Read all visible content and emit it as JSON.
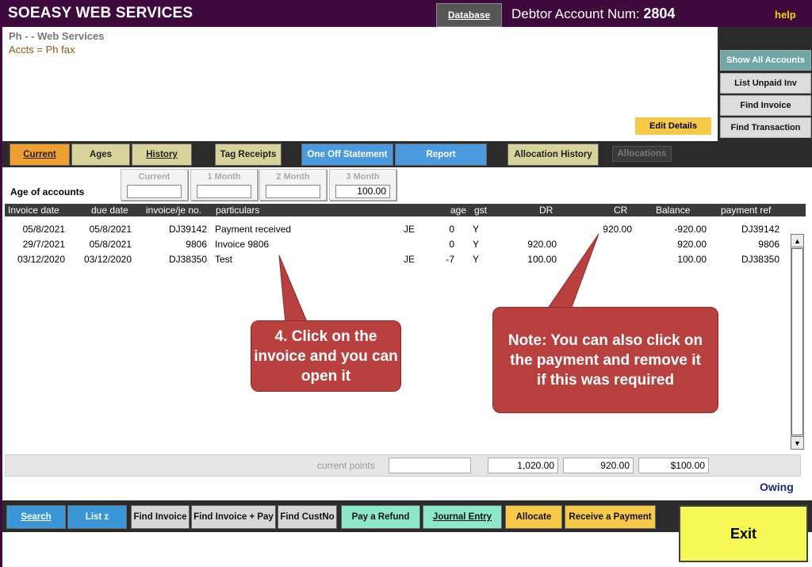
{
  "header": {
    "app_title": "SOEASY WEB SERVICES",
    "database_button": "Database",
    "debtor_label": "Debtor Account Num:",
    "debtor_number": "2804",
    "help": "help"
  },
  "info": {
    "line1": "Ph  -  - Web Services",
    "line2": "Accts =  Ph  fax"
  },
  "side_buttons": {
    "show_all": "Show All Accounts",
    "list_unpaid": "List Unpaid Inv",
    "find_invoice": "Find Invoice",
    "find_transaction": "Find Transaction"
  },
  "edit_details": "Edit Details",
  "tabs": {
    "current": "Current",
    "ages": "Ages",
    "history": "History",
    "tag_receipts": "Tag Receipts",
    "one_off": "One Off Statement",
    "report": "Report",
    "allocation_history": "Allocation History",
    "allocations": "Allocations"
  },
  "ages": {
    "label": "Age of accounts",
    "current_title": "Current",
    "current_value": "",
    "m1_title": "1 Month",
    "m1_value": "",
    "m2_title": "2 Month",
    "m2_value": "",
    "m3_title": "3 Month",
    "m3_value": "100.00"
  },
  "table": {
    "headers": {
      "invoice_date": "Invoice date",
      "due_date": "due date",
      "invoice_no": "invoice/je no.",
      "particulars": "particulars",
      "age": "age",
      "gst": "gst",
      "dr": "DR",
      "cr": "CR",
      "balance": "Balance",
      "payment_ref": "payment ref"
    },
    "rows": [
      {
        "invoice_date": "05/8/2021",
        "due_date": "05/8/2021",
        "invoice_no": "DJ39142",
        "particulars": "Payment received",
        "type": "JE",
        "age": "0",
        "gst": "Y",
        "dr": "",
        "cr": "920.00",
        "balance": "-920.00",
        "payment_ref": "DJ39142"
      },
      {
        "invoice_date": "29/7/2021",
        "due_date": "05/8/2021",
        "invoice_no": "9806",
        "particulars": "Invoice 9806",
        "type": "",
        "age": "0",
        "gst": "Y",
        "dr": "920.00",
        "cr": "",
        "balance": "920.00",
        "payment_ref": "9806"
      },
      {
        "invoice_date": "03/12/2020",
        "due_date": "03/12/2020",
        "invoice_no": "DJ38350",
        "particulars": "Test",
        "type": "JE",
        "age": "-7",
        "gst": "Y",
        "dr": "100.00",
        "cr": "",
        "balance": "100.00",
        "payment_ref": "DJ38350"
      }
    ]
  },
  "totals": {
    "points_label": "current points",
    "points_value": "",
    "dr_total": "1,020.00",
    "cr_total": "920.00",
    "balance_total": "$100.00",
    "owing": "Owing"
  },
  "bottom_buttons": {
    "search": "Search",
    "list_z": "List z",
    "find_invoice": "Find Invoice",
    "find_invoice_pay": "Find Invoice + Pay",
    "find_custno": "Find CustNo",
    "pay_refund": "Pay a Refund",
    "journal_entry": "Journal Entry",
    "allocate": "Allocate",
    "receive_payment": "Receive a Payment",
    "exit": "Exit"
  },
  "callouts": {
    "step4": "4. Click on the invoice and you can open it",
    "note": "Note: You can also click on the payment and remove it if this was required"
  },
  "colors": {
    "header_bg": "#3e0a3e",
    "callout_bg": "#b84140",
    "exit_bg": "#f7f755",
    "current_tab": "#f0a030"
  }
}
